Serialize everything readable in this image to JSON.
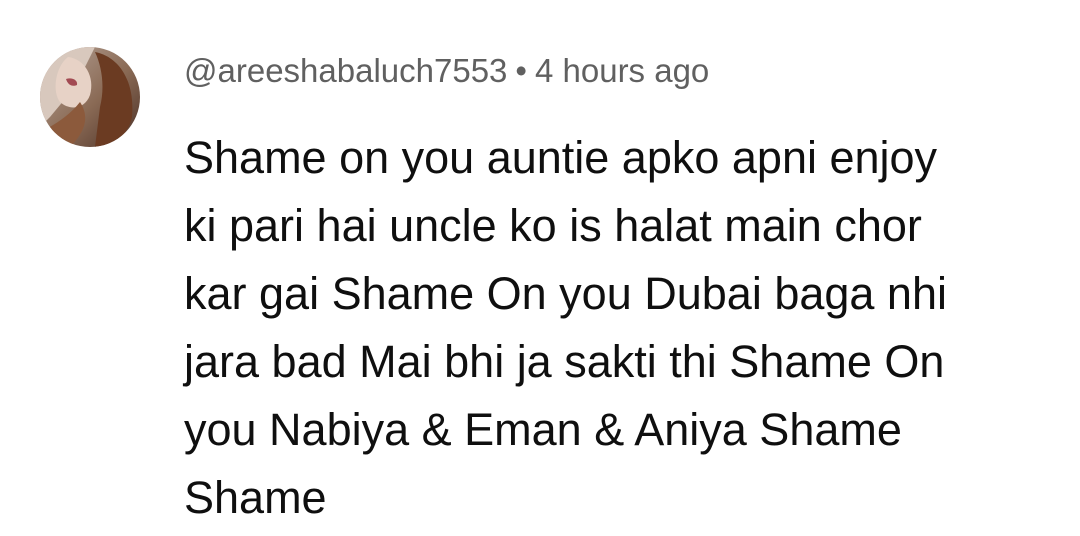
{
  "comment": {
    "author_handle": "@areeshabaluch7553",
    "separator": "•",
    "timestamp": "4 hours ago",
    "text_lines": [
      "Shame on you auntie apko apni enjoy",
      "ki pari hai uncle ko is halat main chor",
      "kar gai Shame On you Dubai baga nhi",
      "jara bad Mai bhi ja sakti thi Shame On",
      "you Nabiya & Eman & Aniya Shame",
      "Shame"
    ]
  },
  "colors": {
    "handle_text": "#606060",
    "body_text": "#0f0f0f",
    "background": "#ffffff"
  }
}
